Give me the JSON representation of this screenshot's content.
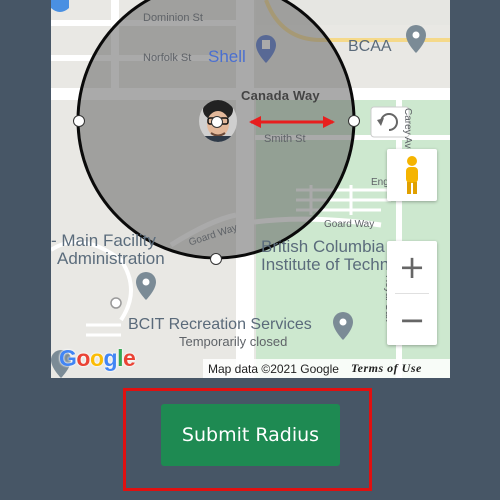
{
  "map": {
    "streets": {
      "dominion": "Dominion St",
      "norfolk": "Norfolk St",
      "canada_way": "Canada Way",
      "smith": "Smith St",
      "english": "English St",
      "goard_left": "Goard Way",
      "goard_right": "Goard Way",
      "carey": "Carey Ave",
      "royal_oak": "Royal Oak"
    },
    "pois": {
      "shell": "Shell",
      "bcaa": "BCAA",
      "facility_line1": "- Main Facility",
      "facility_line2": "Administration",
      "bcit_line1": "British Columbia",
      "bcit_line2": "Institute of Techno",
      "recreation": "BCIT Recreation Services",
      "recreation_status": "Temporarily closed"
    },
    "controls": {
      "zoom_in": "+",
      "zoom_out": "−"
    },
    "attribution": {
      "map_data": "Map data ©2021 Google",
      "terms": "Terms of Use"
    },
    "logo": {
      "letters": [
        "G",
        "o",
        "o",
        "g",
        "l",
        "e"
      ],
      "colors": [
        "#4285F4",
        "#EA4335",
        "#FBBC05",
        "#4285F4",
        "#34A853",
        "#EA4335"
      ]
    },
    "colors": {
      "radius_line": "#e81e1e",
      "circle_fill": "rgba(105,105,105,0.55)",
      "park": "#c8e6c9",
      "pin": "#7b8b96"
    }
  },
  "submit_button": {
    "label": "Submit Radius",
    "color": "#1e8a52"
  },
  "highlight": {
    "color": "#e01010"
  }
}
